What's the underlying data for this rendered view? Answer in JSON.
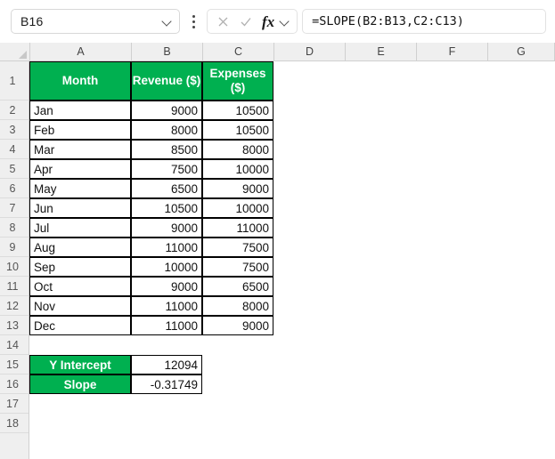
{
  "formula_bar": {
    "name_box_value": "B16",
    "name_box_dropdown_icon": "chevron-down-icon",
    "options_icon": "kebab-menu-icon",
    "cancel_icon": "close-icon",
    "confirm_icon": "check-icon",
    "function_label": "fx",
    "function_dropdown_icon": "chevron-down-icon",
    "formula": "=SLOPE(B2:B13,C2:C13)"
  },
  "sheet": {
    "column_headers": [
      "A",
      "B",
      "C",
      "D",
      "E",
      "F",
      "G"
    ],
    "row_headers": [
      "1",
      "2",
      "3",
      "4",
      "5",
      "6",
      "7",
      "8",
      "9",
      "10",
      "11",
      "12",
      "13",
      "14",
      "15",
      "16",
      "17",
      "18"
    ],
    "table_headers": {
      "month": "Month",
      "revenue": "Revenue ($)",
      "expenses": "Expenses ($)"
    },
    "rows": [
      {
        "month": "Jan",
        "revenue": "9000",
        "expenses": "10500"
      },
      {
        "month": "Feb",
        "revenue": "8000",
        "expenses": "10500"
      },
      {
        "month": "Mar",
        "revenue": "8500",
        "expenses": "8000"
      },
      {
        "month": "Apr",
        "revenue": "7500",
        "expenses": "10000"
      },
      {
        "month": "May",
        "revenue": "6500",
        "expenses": "9000"
      },
      {
        "month": "Jun",
        "revenue": "10500",
        "expenses": "10000"
      },
      {
        "month": "Jul",
        "revenue": "9000",
        "expenses": "11000"
      },
      {
        "month": "Aug",
        "revenue": "11000",
        "expenses": "7500"
      },
      {
        "month": "Sep",
        "revenue": "10000",
        "expenses": "7500"
      },
      {
        "month": "Oct",
        "revenue": "9000",
        "expenses": "6500"
      },
      {
        "month": "Nov",
        "revenue": "11000",
        "expenses": "8000"
      },
      {
        "month": "Dec",
        "revenue": "11000",
        "expenses": "9000"
      }
    ],
    "results": [
      {
        "label": "Y Intercept",
        "value": "12094"
      },
      {
        "label": "Slope",
        "value": "-0.31749"
      }
    ]
  },
  "colors": {
    "header_green": "#00b050",
    "header_text": "#ffffff",
    "grid_header_bg": "#efefef"
  }
}
